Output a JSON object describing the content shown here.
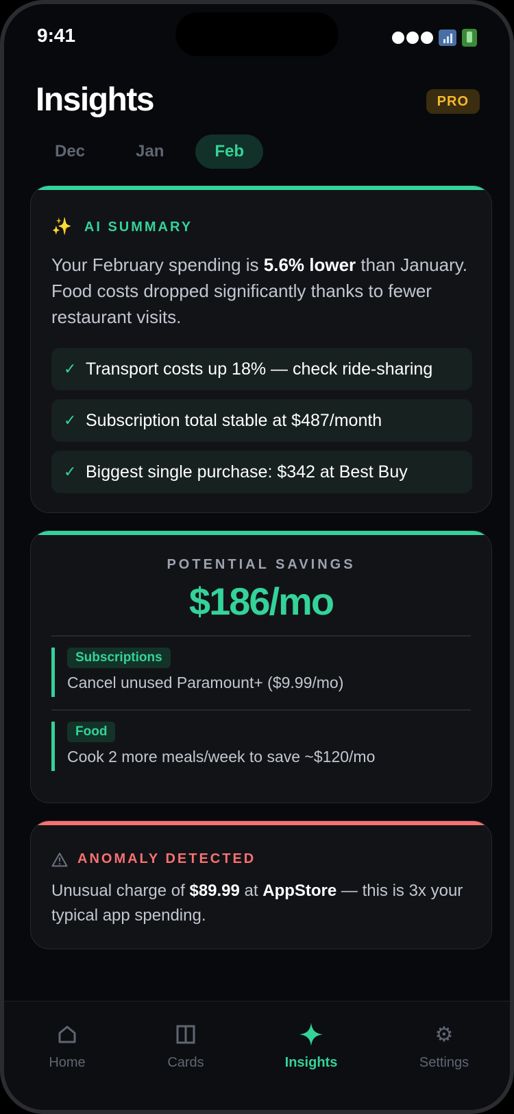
{
  "status_bar": {
    "time": "9:41"
  },
  "header": {
    "title": "Insights",
    "badge": "PRO"
  },
  "tabs": [
    {
      "label": "Dec",
      "active": false
    },
    {
      "label": "Jan",
      "active": false
    },
    {
      "label": "Feb",
      "active": true
    }
  ],
  "ai_summary": {
    "icon": "sparkles-icon",
    "label": "AI SUMMARY",
    "text_before": "Your February spending is ",
    "text_bold": "5.6% lower",
    "text_after": " than January. Food costs dropped significantly thanks to fewer restaurant visits.",
    "points": [
      "Transport costs up 18% — check ride-sharing",
      "Subscription total stable at $487/month",
      "Biggest single purchase: $342 at Best Buy"
    ],
    "check_glyph": "✓"
  },
  "savings": {
    "label": "POTENTIAL SAVINGS",
    "amount": "$186/mo",
    "items": [
      {
        "tag": "Subscriptions",
        "text": "Cancel unused Paramount+ ($9.99/mo)"
      },
      {
        "tag": "Food",
        "text": "Cook 2 more meals/week to save ~$120/mo"
      }
    ]
  },
  "anomaly": {
    "icon": "warning-icon",
    "label": "ANOMALY DETECTED",
    "part1": "Unusual charge of ",
    "amount": "$89.99",
    "part2": " at ",
    "merchant": "AppStore",
    "part3": " — this is 3x your typical app spending."
  },
  "nav": [
    {
      "label": "Home",
      "icon": "home-icon",
      "active": false
    },
    {
      "label": "Cards",
      "icon": "cards-icon",
      "active": false
    },
    {
      "label": "Insights",
      "icon": "sparkle-icon",
      "active": true
    },
    {
      "label": "Settings",
      "icon": "gear-icon",
      "active": false
    }
  ],
  "colors": {
    "accent": "#34d399",
    "danger": "#f87171",
    "pro": "#f5b82e",
    "background": "#08090c",
    "card": "#121317"
  }
}
